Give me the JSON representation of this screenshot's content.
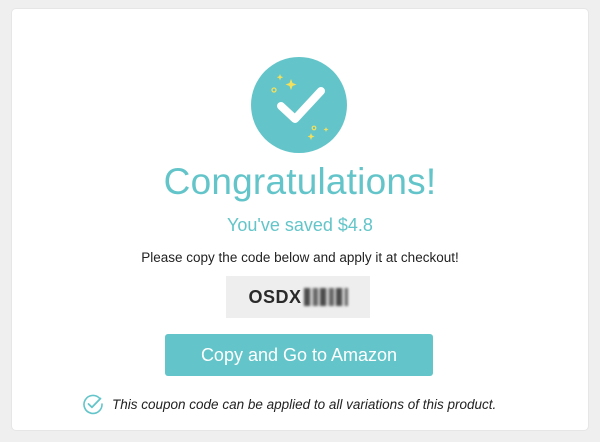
{
  "dialog": {
    "title": "Congratulations!",
    "saved_text": "You've saved $4.8",
    "instruction": "Please copy the code below and apply it at checkout!",
    "coupon_code_visible": "OSDX",
    "cta_label": "Copy and Go to Amazon",
    "note": "This coupon code can be applied to all variations of this product."
  },
  "colors": {
    "accent": "#63c5c9",
    "sparkle": "#f5e05c",
    "code_bg": "#eeeeee",
    "text_dark": "#222222"
  },
  "icons": {
    "badge": "check-circle-icon",
    "note": "check-circle-outline-icon"
  }
}
